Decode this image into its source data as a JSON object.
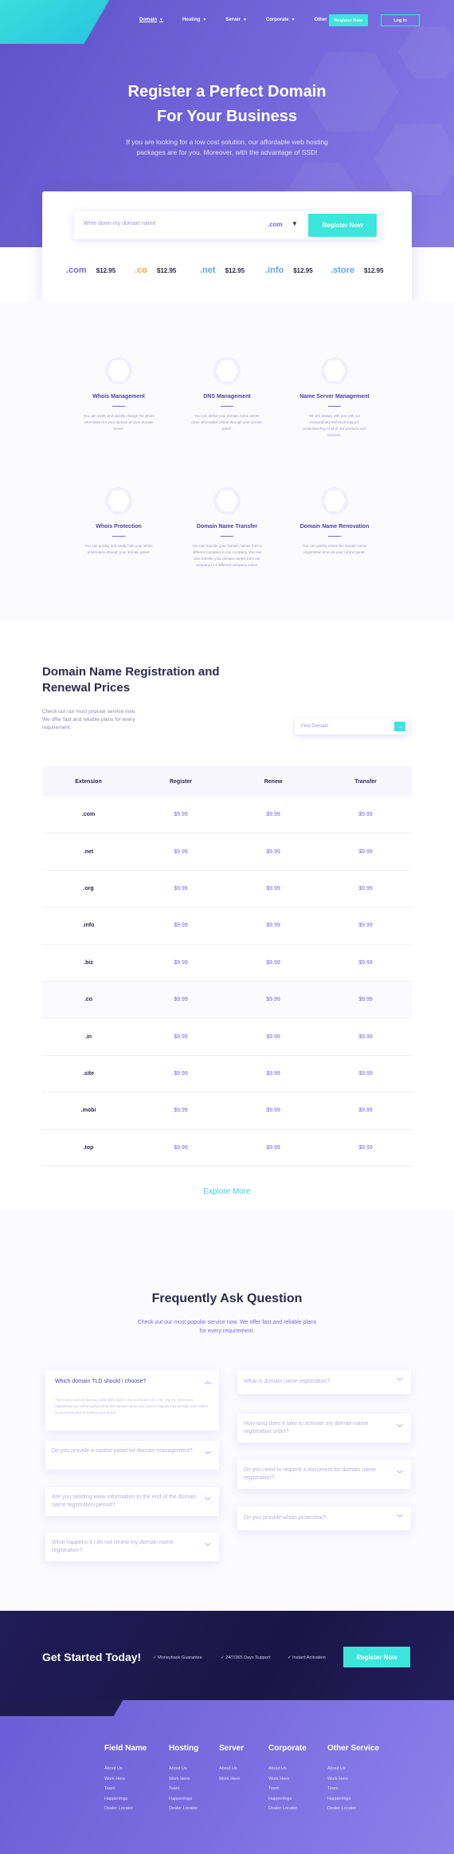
{
  "nav": {
    "items": [
      {
        "label": "Domain"
      },
      {
        "label": "Hosting"
      },
      {
        "label": "Server"
      },
      {
        "label": "Corporate"
      },
      {
        "label": "Other"
      }
    ],
    "register_label": "Register Now",
    "login_label": "Log In"
  },
  "hero": {
    "title_line1": "Register a Perfect Domain",
    "title_line2": "For Your Business",
    "subtitle": "If you are looking for a low cost solution, our affordable web hosting packages are for you. Moreover, with the advantage of SSD!"
  },
  "search": {
    "placeholder": "Write down my domain name",
    "tld": ".com",
    "button": "Register Now",
    "tlds": [
      {
        "ext": ".com",
        "price": "$12.95",
        "color": "#7868e6"
      },
      {
        "ext": ".co",
        "price": "$12.95",
        "color": "#f5a43c"
      },
      {
        "ext": ".net",
        "price": "$12.95",
        "color": "#5aa8f0"
      },
      {
        "ext": ".info",
        "price": "$12.95",
        "color": "#5aa8f0"
      },
      {
        "ext": ".store",
        "price": "$12.95",
        "color": "#5aa8f0"
      }
    ]
  },
  "features": [
    {
      "title": "Whois Management",
      "text": "You can easily and quickly change the whois information for your domain on your domain panel."
    },
    {
      "title": "DNS Management",
      "text": "You can define your domain name server (dns) information online through your domain panel."
    },
    {
      "title": "Name Server Management",
      "text": "We are always with you with our extraordinary technical support, understanding of all of our products and services."
    },
    {
      "title": "Whois Protection",
      "text": "You can quickly and easily hide your whois information through your domain panel."
    },
    {
      "title": "Domain Name Transfer",
      "text": "You can transfer your domain names from a different company to our company. You can also transfer your domain names from our company to a different company online."
    },
    {
      "title": "Domain Name Renovation",
      "text": "You can quickly renew the domain name registration time via your control panel."
    }
  ],
  "pricing": {
    "title": "Domain Name Registration and Renewal Prices",
    "desc": "Check out our most popular service now. We offer fast and reliable plans for every requirement.",
    "find_placeholder": "Find Domain",
    "find_icon": "arrow-right-icon",
    "headers": [
      "Extension",
      "Register",
      "Renew",
      "Transfer"
    ],
    "rows": [
      [
        ".com",
        "$9.99",
        "$9.99",
        "$9.99"
      ],
      [
        ".net",
        "$9.99",
        "$9.99",
        "$9.99"
      ],
      [
        ".org",
        "$9.99",
        "$9.99",
        "$9.99"
      ],
      [
        ".info",
        "$9.99",
        "$9.99",
        "$9.99"
      ],
      [
        ".biz",
        "$9.99",
        "$9.99",
        "$9.99"
      ],
      [
        ".co",
        "$9.99",
        "$9.99",
        "$9.99"
      ],
      [
        ".in",
        "$9.99",
        "$9.99",
        "$9.99"
      ],
      [
        ".site",
        "$9.99",
        "$9.99",
        "$9.99"
      ],
      [
        ".mobi",
        "$9.99",
        "$9.99",
        "$9.99"
      ],
      [
        ".top",
        "$9.99",
        "$9.99",
        "$9.99"
      ]
    ],
    "explore": "Explore More"
  },
  "faq": {
    "title": "Frequently Ask Question",
    "desc": "Check out our most popular service now. We offer fast and reliable plans for every requirement.",
    "left": [
      {
        "q": "Which domain TLD should I choose?",
        "a": "The most common domain suffix (tld) used in the world are com, net, org etc. Moreover, registering one of the suffixes that the domain name you want to register has already been taken is recommended to protect your brand."
      },
      {
        "q": "Do you provide a control panel for domain management?"
      },
      {
        "q": "Are you sending www information to the end of the domain name registration period?"
      },
      {
        "q": "What happens if I do not renew my domain name registration?"
      }
    ],
    "right": [
      {
        "q": "What is domain name registration?"
      },
      {
        "q": "How long does it take to activate my domain name registration order?"
      },
      {
        "q": "Do you need to request a document for domain name registration?"
      },
      {
        "q": "Do you provide whois protection?"
      }
    ]
  },
  "cta": {
    "title": "Get Started Today!",
    "checks": [
      "Moneyback Guarantee",
      "24/7/365 Days Support",
      "Instant Activation"
    ],
    "button": "Register Now"
  },
  "footer": {
    "columns": [
      {
        "title": "Field Name",
        "links": [
          "About Us",
          "Work Here",
          "Team",
          "Happenings",
          "Dealer Locator"
        ]
      },
      {
        "title": "Hosting",
        "links": [
          "About Us",
          "Work Here",
          "Team",
          "Happenings",
          "Dealer Locator"
        ]
      },
      {
        "title": "Server",
        "links": [
          "About Us",
          "Work Here"
        ]
      },
      {
        "title": "Corporate",
        "links": [
          "About Us",
          "Work Here",
          "Team",
          "Happenings",
          "Dealer Locator"
        ]
      },
      {
        "title": "Other Service",
        "links": [
          "About Us",
          "Work Here",
          "Team",
          "Happenings",
          "Dealer Locator"
        ]
      }
    ]
  },
  "colors": {
    "accent": "#3ce6dc",
    "brand": "#7868e6",
    "dark": "#1a1546"
  }
}
